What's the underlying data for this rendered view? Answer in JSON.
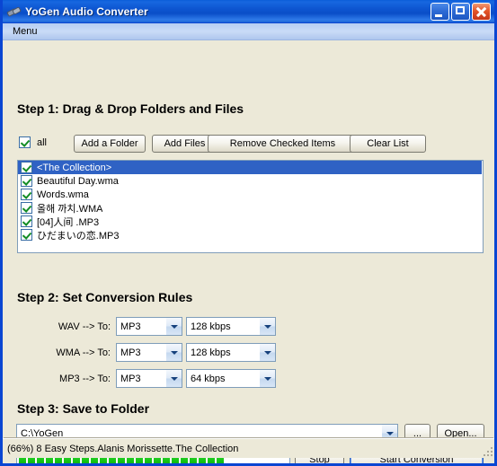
{
  "window": {
    "title": "YoGen Audio Converter",
    "icon": "app-icon",
    "buttons": {
      "minimize": "minimize-icon",
      "maximize": "maximize-icon",
      "close": "close-icon"
    }
  },
  "menubar": {
    "items": [
      "Menu"
    ]
  },
  "step1": {
    "heading": "Step 1: Drag & Drop Folders and Files",
    "all_checkbox_label": "all",
    "all_checked": true,
    "buttons": {
      "add_folder": "Add a Folder",
      "add_files": "Add Files",
      "remove_checked": "Remove Checked Items",
      "clear_list": "Clear List"
    },
    "files": [
      {
        "label": "<The Collection>",
        "checked": true,
        "selected": true
      },
      {
        "label": "Beautiful Day.wma",
        "checked": true,
        "selected": false
      },
      {
        "label": "Words.wma",
        "checked": true,
        "selected": false
      },
      {
        "label": "올해 까치.WMA",
        "checked": true,
        "selected": false
      },
      {
        "label": "[04]人间 .MP3",
        "checked": true,
        "selected": false
      },
      {
        "label": "ひだまいの恋.MP3",
        "checked": true,
        "selected": false
      }
    ]
  },
  "step2": {
    "heading": "Step 2: Set Conversion Rules",
    "rules": [
      {
        "label": "WAV --> To:",
        "format": "MP3",
        "bitrate": "128 kbps"
      },
      {
        "label": "WMA --> To:",
        "format": "MP3",
        "bitrate": "128 kbps"
      },
      {
        "label": "MP3 --> To:",
        "format": "MP3",
        "bitrate": "64 kbps"
      }
    ]
  },
  "step3": {
    "heading": "Step 3: Save to Folder",
    "folder_path": "C:\\YoGen",
    "browse_button": "...",
    "open_button": "Open...",
    "stop_button": "Stop",
    "start_button": "Start Conversion",
    "progress_percent": 66,
    "progress_segments": 23
  },
  "statusbar": {
    "text": "(66%) 8 Easy Steps.Alanis Morissette.The Collection"
  },
  "colors": {
    "window_bg": "#ece9d8",
    "title_blue": "#0a46d2",
    "selection_blue": "#2f62c4",
    "progress_green": "#16c516",
    "check_green": "#138c24"
  }
}
